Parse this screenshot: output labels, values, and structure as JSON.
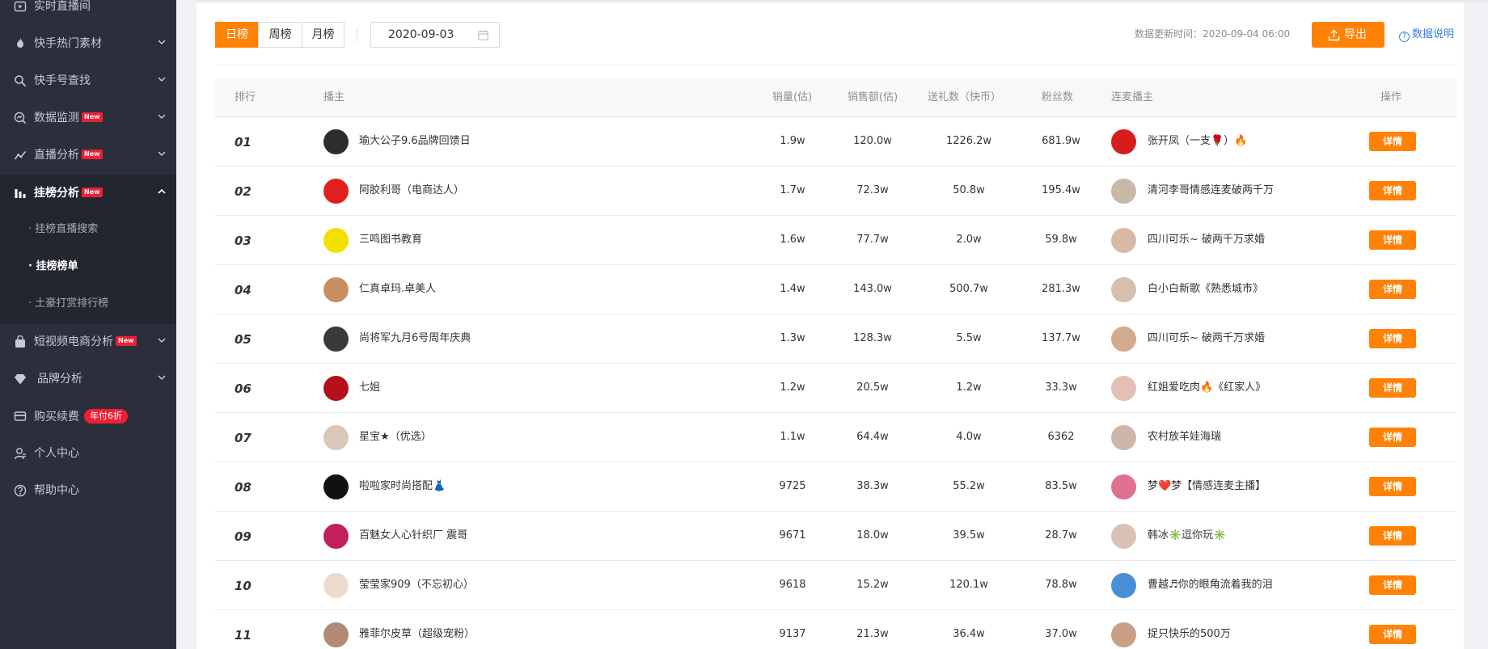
{
  "sidebar": {
    "items": [
      {
        "label": "实时直播间",
        "icon": "play-icon"
      },
      {
        "label": "快手热门素材",
        "icon": "fire-icon"
      },
      {
        "label": "快手号查找",
        "icon": "search-icon"
      },
      {
        "label": "数据监测",
        "icon": "monitor-icon",
        "badge": "New"
      },
      {
        "label": "直播分析",
        "icon": "trend-icon",
        "badge": "New"
      },
      {
        "label": "挂榜分析",
        "icon": "bar-chart-icon",
        "badge": "New"
      },
      {
        "label": "短视频电商分析",
        "icon": "bag-icon",
        "badge": "New"
      },
      {
        "label": "品牌分析",
        "icon": "diamond-icon"
      },
      {
        "label": "购买续费",
        "icon": "card-icon",
        "badge": "年付6折"
      },
      {
        "label": "个人中心",
        "icon": "user-icon"
      },
      {
        "label": "帮助中心",
        "icon": "question-icon"
      }
    ],
    "sub_items": [
      "· 挂榜直播搜索",
      "· 挂榜榜单",
      "· 土豪打赏排行榜"
    ]
  },
  "filters": {
    "tabs": [
      "日榜",
      "周榜",
      "月榜"
    ],
    "active_tab": "日榜",
    "date": "2020-09-03"
  },
  "header": {
    "update_label": "数据更新时间：2020-09-04 06:00",
    "export_label": "导出",
    "help_label": "数据说明"
  },
  "table": {
    "columns": [
      "排行",
      "播主",
      "销量(估)",
      "销售额(估)",
      "送礼数（快币）",
      "粉丝数",
      "连麦播主",
      "操作"
    ],
    "detail_label": "详情",
    "rows": [
      {
        "rank": "01",
        "name": "瑜大公子9.6品牌回馈日",
        "sales": "1.9w",
        "revenue": "120.0w",
        "gifts": "1226.2w",
        "fans": "681.9w",
        "partner": "张开凤（一支🌹）🔥"
      },
      {
        "rank": "02",
        "name": "阿胶利哥（电商达人）",
        "sales": "1.7w",
        "revenue": "72.3w",
        "gifts": "50.8w",
        "fans": "195.4w",
        "partner": "清河李哥情感连麦破两千万"
      },
      {
        "rank": "03",
        "name": "三鸣图书教育",
        "sales": "1.6w",
        "revenue": "77.7w",
        "gifts": "2.0w",
        "fans": "59.8w",
        "partner": "四川可乐~ 破两千万求婚"
      },
      {
        "rank": "04",
        "name": "仁真卓玛.卓美人",
        "sales": "1.4w",
        "revenue": "143.0w",
        "gifts": "500.7w",
        "fans": "281.3w",
        "partner": "白小白新歌《熟悉城市》"
      },
      {
        "rank": "05",
        "name": "尚将军九月6号周年庆典",
        "sales": "1.3w",
        "revenue": "128.3w",
        "gifts": "5.5w",
        "fans": "137.7w",
        "partner": "四川可乐~ 破两千万求婚"
      },
      {
        "rank": "06",
        "name": "七姐",
        "sales": "1.2w",
        "revenue": "20.5w",
        "gifts": "1.2w",
        "fans": "33.3w",
        "partner": "红姐爱吃肉🔥《红家人》"
      },
      {
        "rank": "07",
        "name": "星宝★（优选）",
        "sales": "1.1w",
        "revenue": "64.4w",
        "gifts": "4.0w",
        "fans": "6362",
        "partner": "农村放羊娃海瑞"
      },
      {
        "rank": "08",
        "name": "啦啦家时尚搭配👗",
        "sales": "9725",
        "revenue": "38.3w",
        "gifts": "55.2w",
        "fans": "83.5w",
        "partner": "梦❤️梦【情感连麦主播】"
      },
      {
        "rank": "09",
        "name": "百魅女人心针织厂 震哥",
        "sales": "9671",
        "revenue": "18.0w",
        "gifts": "39.5w",
        "fans": "28.7w",
        "partner": "韩冰✳️逗你玩✳️"
      },
      {
        "rank": "10",
        "name": "莹莹家909（不忘初心）",
        "sales": "9618",
        "revenue": "15.2w",
        "gifts": "120.1w",
        "fans": "78.8w",
        "partner": "曹越♬你的眼角流着我的泪"
      },
      {
        "rank": "11",
        "name": "雅菲尔皮草（超级宠粉）",
        "sales": "9137",
        "revenue": "21.3w",
        "gifts": "36.4w",
        "fans": "37.0w",
        "partner": "捉只快乐的500万"
      }
    ]
  },
  "colors": {
    "sidebar_bg": "#2b2e3b",
    "accent": "#ff8106",
    "badge_red": "#ee1f34",
    "link_blue": "#3a7de3"
  }
}
